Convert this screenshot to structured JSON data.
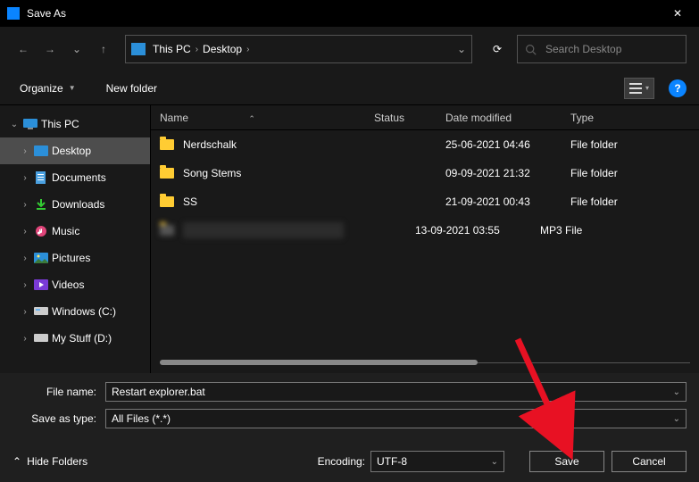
{
  "window": {
    "title": "Save As",
    "close_icon": "✕"
  },
  "nav": {
    "back": "←",
    "forward": "→",
    "recent_dd": "⌄",
    "up": "↑",
    "refresh": "⟳",
    "addr_dd": "⌄"
  },
  "breadcrumb": {
    "root": "This PC",
    "sep": "›",
    "leaf": "Desktop"
  },
  "search": {
    "placeholder": "Search Desktop",
    "icon": "🔍"
  },
  "toolbar": {
    "organize": "Organize",
    "new_folder": "New folder",
    "view_dd": "▾",
    "help": "?"
  },
  "columns": {
    "name": "Name",
    "status": "Status",
    "date": "Date modified",
    "type": "Type",
    "sort_indicator": "⌃"
  },
  "tree": {
    "root": "This PC",
    "items": [
      {
        "label": "Desktop",
        "selected": true
      },
      {
        "label": "Documents"
      },
      {
        "label": "Downloads"
      },
      {
        "label": "Music"
      },
      {
        "label": "Pictures"
      },
      {
        "label": "Videos"
      },
      {
        "label": "Windows (C:)"
      },
      {
        "label": "My Stuff (D:)"
      }
    ]
  },
  "files": [
    {
      "name": "Nerdschalk",
      "date": "25-06-2021 04:46",
      "type": "File folder",
      "kind": "folder"
    },
    {
      "name": "Song Stems",
      "date": "09-09-2021 21:32",
      "type": "File folder",
      "kind": "folder"
    },
    {
      "name": "SS",
      "date": "21-09-2021 00:43",
      "type": "File folder",
      "kind": "folder"
    },
    {
      "name": "",
      "date": "13-09-2021 03:55",
      "type": "MP3 File",
      "kind": "blurred"
    }
  ],
  "fields": {
    "filename_label": "File name:",
    "filename_value": "Restart explorer.bat",
    "savetype_label": "Save as type:",
    "savetype_value": "All Files  (*.*)"
  },
  "footer": {
    "hide_folders": "Hide Folders",
    "hide_chev": "⌃",
    "encoding_label": "Encoding:",
    "encoding_value": "UTF-8",
    "save": "Save",
    "cancel": "Cancel"
  }
}
